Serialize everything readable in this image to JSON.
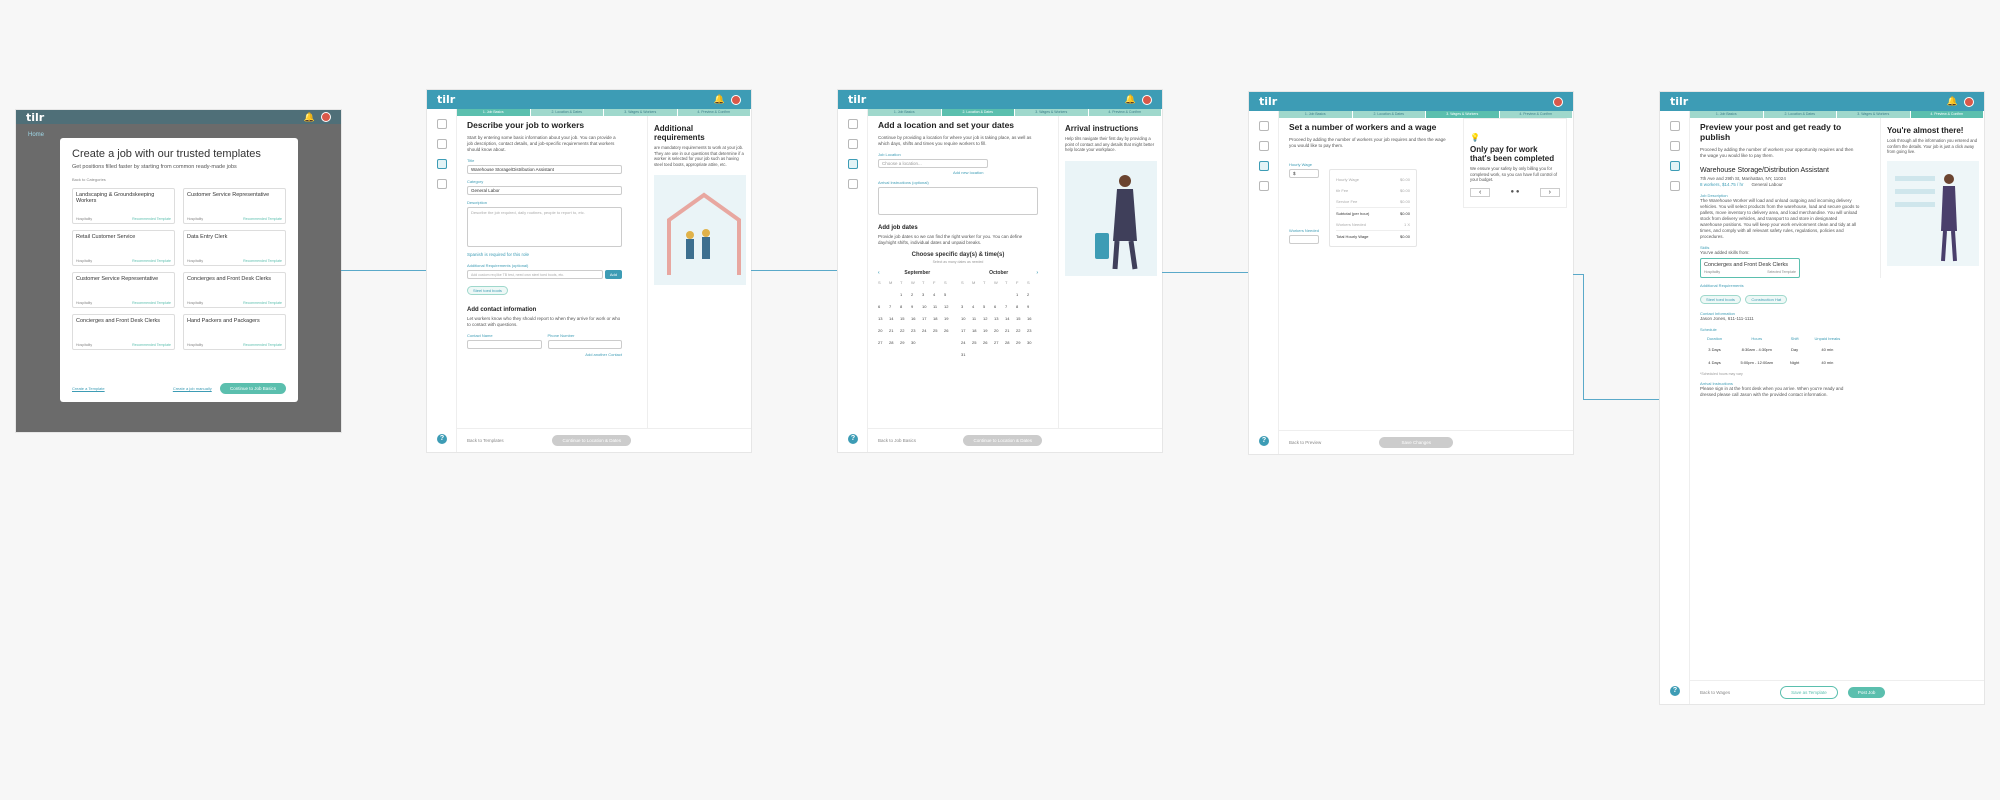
{
  "colors": {
    "brand": "#3d9cb5",
    "accent": "#5bbfae",
    "connector": "#5aa9c9"
  },
  "app": {
    "logo": "tilr"
  },
  "steps": [
    "1. Job Basics",
    "2. Location & Dates",
    "3. Wages & Workers",
    "4. Preview & Confirm"
  ],
  "frame1": {
    "title": "Create a job with our trusted templates",
    "subtitle": "Get positions filled faster by starting from common ready-made jobs",
    "back": "Back to Categories",
    "templates": [
      {
        "name": "Landscaping & Groundskeeping Workers",
        "cat": "Hospitality",
        "badge": "Recommended Template"
      },
      {
        "name": "Customer Service Representative",
        "cat": "Hospitality",
        "badge": "Recommended Template"
      },
      {
        "name": "Retail Customer Service",
        "cat": "Hospitality",
        "badge": "Recommended Template"
      },
      {
        "name": "Data Entry Clerk",
        "cat": "Hospitality",
        "badge": "Recommended Template"
      },
      {
        "name": "Customer Service Representative",
        "cat": "Hospitality",
        "badge": "Recommended Template"
      },
      {
        "name": "Concierges and Front Desk Clerks",
        "cat": "Hospitality",
        "badge": "Recommended Template"
      },
      {
        "name": "Concierges and Front Desk Clerks",
        "cat": "Hospitality",
        "badge": "Recommended Template"
      },
      {
        "name": "Hand Packers and Packagers",
        "cat": "Hospitality",
        "badge": "Recommended Template"
      }
    ],
    "create_template": "Create a Template",
    "create_manually": "Create a job manually",
    "continue": "Continue to Job Basics",
    "sidebar_home": "Home"
  },
  "frame2": {
    "heading": "Describe your job to workers",
    "intro": "Start by entering some basic information about your job. You can provide a job description, contact details, and job-specific requirements that workers should know about.",
    "title_label": "Title",
    "title_value": "Warehouse Storage/Distribution Assistant",
    "category_label": "Category",
    "category_value": "General Labor",
    "desc_label": "Description",
    "desc_placeholder": "Describe the job required, daily routines, people to report to, etc.",
    "spanish": "Spanish is required for this role",
    "addl_label": "Additional Requirements (optional)",
    "addl_placeholder": "Add custom req like TB test, need own steel toed boots, etc.",
    "add_btn": "Add",
    "chip": "Steel toed boots",
    "contact_heading": "Add contact information",
    "contact_text": "Let workers know who they should report to when they arrive for work or who to contact with questions.",
    "contact_name": "Contact Name",
    "phone": "Phone Number",
    "add_contact": "Add another Contact",
    "back": "Back to Templates",
    "continue": "Continue to Location & Dates",
    "panel_title": "Additional requirements",
    "panel_text": "are mandatory requirements to work at your job. They are use in our questions that determine if a worker is selected for your job such as having steel toed boots, appropriate attire, etc."
  },
  "frame3": {
    "heading": "Add a location and set your dates",
    "intro": "Continue by providing a location for where your job is taking place, as well as which days, shifts and times you require workers to fill.",
    "loc_label": "Job Location",
    "loc_placeholder": "Choose a location...",
    "add_loc": "Add new location",
    "arr_label": "Arrival Instructions (optional)",
    "dates_heading": "Add job dates",
    "dates_text": "Provide job dates so we can find the right worker for you. You can define day/night shifts, individual dates and unpaid breaks.",
    "choose": "Choose specific day(s) & time(s)",
    "select_hint": "Select as many dates as needed",
    "month1": "September",
    "month2": "October",
    "back": "Back to Job Basics",
    "continue": "Continue to Location & Dates",
    "panel_title": "Arrival instructions",
    "panel_text": "Help tilrs navigate their first day by providing a point of contact and any details that might better help locate your workplace."
  },
  "frame4": {
    "heading": "Set a number of workers and a wage",
    "intro": "Proceed by adding the number of workers your job requires and then the wage you would like to pay them.",
    "wage_label": "Hourly Wage",
    "workers_label": "Workers Needed",
    "rows": [
      {
        "k": "Hourly Wage",
        "v": "$0.00"
      },
      {
        "k": "tilr Fee",
        "v": "$0.00"
      },
      {
        "k": "Service Fee",
        "v": "$0.00"
      },
      {
        "k": "Subtotal (per hour)",
        "v": "$0.00"
      },
      {
        "k": "Workers Needed",
        "v": "1 X"
      },
      {
        "k": "Total Hourly Wage",
        "v": "$0.00"
      }
    ],
    "back": "Back to Preview",
    "continue": "Save Changes",
    "panel_title": "Only pay for work that's been completed",
    "panel_text": "We ensure your safety by only billing you for completed work, so you can have full control of your budget."
  },
  "frame5": {
    "heading": "Preview your post and get ready to publish",
    "intro": "Proceed by adding the number of workers your opportunity requires and then the wage you would like to pay them.",
    "job_title": "Warehouse Storage/Distribution Assistant",
    "address": "7th Ave and 29th St, Manhattan, NY, 11024",
    "workers": "8 workers, $14.75 / hr",
    "category": "General Labour",
    "desc_label": "Job Description",
    "desc": "The Warehouse Worker will load and unload outgoing and incoming delivery vehicles. You will select products from the warehouse, load and secure goods to pallets, move inventory to delivery area, and load merchandise. You will unload stock from delivery vehicles, and transport to and store in designated warehouse positions. You will keep your work environment clean and tidy at all times, and comply with all relevant safety rules, regulations, policies and procedures.",
    "skills_label": "Skills",
    "skills_added": "You've added skills from:",
    "skill_card": "Concierges and Front Desk Clerks",
    "skill_cat": "Hospitality",
    "skill_badge": "Selected Template",
    "req_label": "Additional Requirements",
    "reqs": [
      "Steel toed boots",
      "Construction Hat"
    ],
    "contact_label": "Contact Information",
    "contact": "Jason Jones, 611-111-1111",
    "schedule_label": "Schedule",
    "sched_headers": [
      "Duration",
      "Hours",
      "Shift",
      "Unpaid breaks"
    ],
    "sched_rows": [
      [
        "3 Days",
        "8:30am - 4:30pm",
        "Day",
        "40 min"
      ],
      [
        "4 Days",
        "5:00pm - 12:00am",
        "Night",
        "40 min"
      ]
    ],
    "sched_note": "*Scheduled hours may vary",
    "arr_label": "Arrival Instructions",
    "arr_text": "Please sign in at the front desk when you arrive. When you're ready and dressed please call Jason with the provided contact information.",
    "back": "Back to Wages",
    "save_template": "Save as Template",
    "post": "Post Job",
    "panel_title": "You're almost there!",
    "panel_text": "Look through all the information you entered and confirm the details. Your job is just a click away from going live."
  }
}
